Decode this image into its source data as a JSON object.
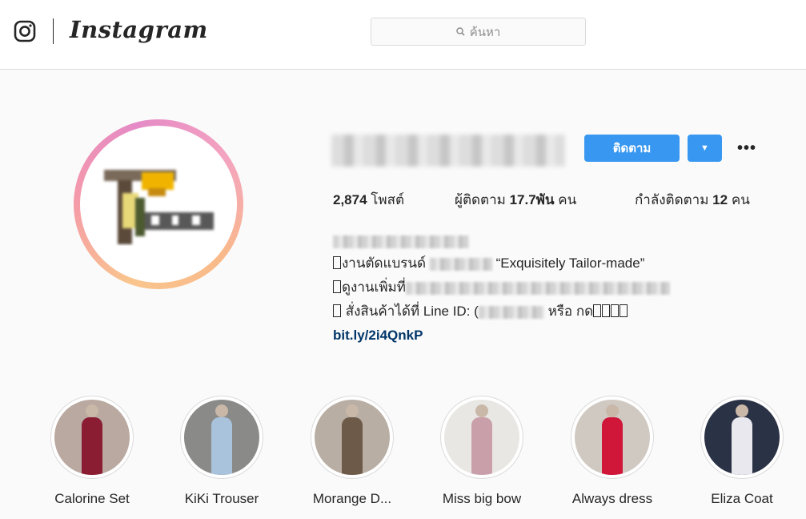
{
  "header": {
    "logo_text": "Instagram",
    "search_placeholder": "ค้นหา"
  },
  "profile": {
    "follow_button": "ติดตาม",
    "dropdown_arrow": "▼",
    "more_options": "•••",
    "stats": {
      "posts_count": "2,874",
      "posts_label": "โพสต์",
      "followers_label": "ผู้ติดตาม",
      "followers_count": "17.7พัน",
      "followers_unit": "คน",
      "following_label": "กำลังติดตาม",
      "following_count": "12",
      "following_unit": "คน"
    },
    "bio": {
      "line1_text": "งานตัดแบรนด์",
      "line1_quote": "“Exquisitely Tailor-made”",
      "line2_text": "ดูงานเพิ่มที่",
      "line3_prefix": "สั่งสินค้าได้ที่ Line ID: (",
      "line3_suffix": "หรือ กด",
      "link": "bit.ly/2i4QnkP"
    }
  },
  "highlights": [
    {
      "label": "Calorine Set",
      "bg": "#b9a9a0",
      "figure": "#8b1d33"
    },
    {
      "label": "KiKi Trouser",
      "bg": "#8a8a88",
      "figure": "#a9c3dc"
    },
    {
      "label": "Morange D...",
      "bg": "#b8aea4",
      "figure": "#6e5a48"
    },
    {
      "label": "Miss big bow",
      "bg": "#e9e7e3",
      "figure": "#c9a0aa"
    },
    {
      "label": "Always dress",
      "bg": "#cfc9c2",
      "figure": "#d0173a"
    },
    {
      "label": "Eliza Coat",
      "bg": "#2a3245",
      "figure": "#e8e8ee"
    }
  ]
}
